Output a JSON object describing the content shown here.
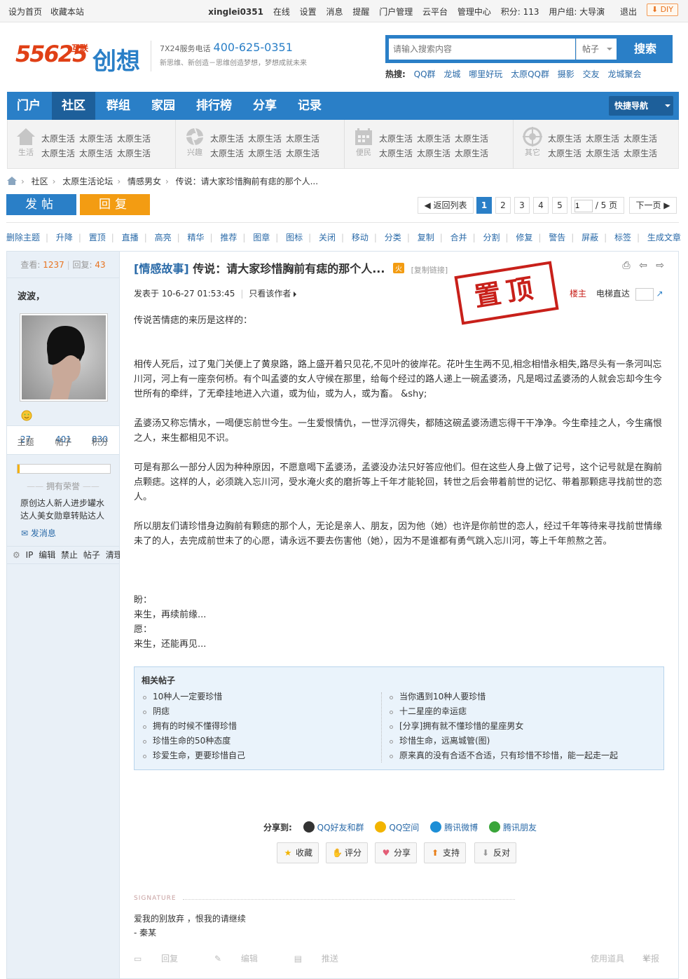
{
  "topbar": {
    "left_links": [
      "设为首页",
      "收藏本站"
    ],
    "username": "xinglei0351",
    "right_links": [
      "在线",
      "设置",
      "消息",
      "提醒",
      "门户管理",
      "云平台",
      "管理中心"
    ],
    "points": "积分: 113",
    "usergroup": "用户组: 大导演",
    "logout": "退出",
    "diy": "DIY"
  },
  "header": {
    "logo_num": "55625",
    "logo_small": "互联",
    "logo_cx": "创想",
    "service_label": "7X24服务电话",
    "phone": "400-625-0351",
    "slogan": "新思维、新创造－思维创造梦想，梦想成就未来",
    "search_placeholder": "请输入搜索内容",
    "search_type": "帖子",
    "search_button": "搜索",
    "hot_label": "热搜:",
    "hot_items": [
      "QQ群",
      "龙城",
      "哪里好玩",
      "太原QQ群",
      "摄影",
      "交友",
      "龙城聚会"
    ]
  },
  "nav": {
    "items": [
      "门户",
      "社区",
      "群组",
      "家园",
      "排行榜",
      "分享",
      "记录"
    ],
    "quick": "快捷导航"
  },
  "subnav": {
    "groups": [
      {
        "icon": "house-icon",
        "label": "生活",
        "row1": [
          "太原生活",
          "太原生活",
          "太原生活"
        ],
        "row2": [
          "太原生活",
          "太原生活",
          "太原生活"
        ]
      },
      {
        "icon": "aperture-icon",
        "label": "兴趣",
        "row1": [
          "太原生活",
          "太原生活",
          "太原生活"
        ],
        "row2": [
          "太原生活",
          "太原生活",
          "太原生活"
        ]
      },
      {
        "icon": "calendar-icon",
        "label": "便民",
        "row1": [
          "太原生活",
          "太原生活",
          "太原生活"
        ],
        "row2": [
          "太原生活",
          "太原生活",
          "太原生活"
        ]
      },
      {
        "icon": "globe-icon",
        "label": "其它",
        "row1": [
          "太原生活",
          "太原生活",
          "太原生活"
        ],
        "row2": [
          "太原生活",
          "太原生活",
          "太原生活"
        ]
      }
    ]
  },
  "breadcrumb": [
    "社区",
    "太原生活论坛",
    "情感男女",
    "传说：请大家珍惜胸前有痣的那个人..."
  ],
  "actions": {
    "post": "发帖",
    "reply": "回复"
  },
  "pager": {
    "back": "返回列表",
    "pages": [
      "1",
      "2",
      "3",
      "4",
      "5"
    ],
    "current": "1",
    "input": "1",
    "total": "/ 5 页",
    "next": "下一页"
  },
  "modbar": [
    "删除主题",
    "升降",
    "置顶",
    "直播",
    "高亮",
    "精华",
    "推荐",
    "图章",
    "图标",
    "关闭",
    "移动",
    "分类",
    "复制",
    "合并",
    "分割",
    "修复",
    "警告",
    "屏蔽",
    "标签",
    "生成文章"
  ],
  "author": {
    "views_label": "查看:",
    "views": "1237",
    "replies_label": "回复:",
    "replies": "43",
    "name": "波波，",
    "stats": [
      {
        "value": "27",
        "label": "主题"
      },
      {
        "value": "401",
        "label": "帖子"
      },
      {
        "value": "830",
        "label": "积分"
      }
    ],
    "level_progress": 0.02,
    "honor_label": "拥有荣誉",
    "medals": "原创达人新人进步罐水达人美女勋章转贴达人",
    "message": "发消息",
    "ops": [
      "IP",
      "编辑",
      "禁止",
      "帖子",
      "清理"
    ]
  },
  "post": {
    "category": "[情感故事]",
    "title": "传说：请大家珍惜胸前有痣的那个人...",
    "hot_badge": "火",
    "copy_link": "[复制链接]",
    "posted": "发表于 10-6-27 01:53:45",
    "only_author": "只看该作者",
    "stamp": "置顶",
    "owner": "楼主",
    "elevator": "电梯直达",
    "paragraphs": [
      "传说苦情痣的来历是这样的：",
      "",
      "相传人死后，过了鬼门关便上了黄泉路，路上盛开着只见花,不见叶的彼岸花。花叶生生两不见,相念相惜永相失,路尽头有一条河叫忘川河，河上有一座奈何桥。有个叫孟婆的女人守候在那里，给每个经过的路人递上一碗孟婆汤，凡是喝过孟婆汤的人就会忘却今生今世所有的牵绊，了无牵挂地进入六道，或为仙，或为人，或为畜。 &shy;",
      "孟婆汤又称忘情水，一喝便忘前世今生。一生爱恨情仇，一世浮沉得失，都随这碗孟婆汤遗忘得干干净净。今生牵挂之人，今生痛恨之人，来生都相见不识。",
      "可是有那么一部分人因为种种原因，不愿意喝下孟婆汤，孟婆没办法只好答应他们。但在这些人身上做了记号，这个记号就是在胸前点颗痣。这样的人，必须跳入忘川河，受水淹火炙的磨折等上千年才能轮回，转世之后会带着前世的记忆、带着那颗痣寻找前世的恋人。",
      "所以朋友们请珍惜身边胸前有颗痣的那个人，无论是亲人、朋友，因为他（她）也许是你前世的恋人，经过千年等待来寻找前世情缘未了的人，去完成前世未了的心愿，请永远不要去伤害他（她），因为不是谁都有勇气跳入忘川河，等上千年煎熬之苦。"
    ],
    "ending": [
      "盼：",
      "来生，再续前缘...",
      "愿：",
      "来生，还能再见..."
    ]
  },
  "related": {
    "title": "相关帖子",
    "left": [
      "10种人一定要珍惜",
      "阴痣",
      "拥有的时候不懂得珍惜",
      "珍惜生命的50种态度",
      "珍爱生命，更要珍惜自己"
    ],
    "right": [
      "当你遇到10种人要珍惜",
      "十二星座的幸运痣",
      "[分享]拥有就不懂珍惜的星座男女",
      "珍惜生命，远离城管(图)",
      "原来真的没有合适不合适，只有珍惜不珍惜，能一起走一起"
    ]
  },
  "share": {
    "label": "分享到:",
    "targets": [
      {
        "name": "QQ好友和群",
        "color": "#333333"
      },
      {
        "name": "QQ空间",
        "color": "#f2b400"
      },
      {
        "name": "腾讯微博",
        "color": "#1d8ed6"
      },
      {
        "name": "腾讯朋友",
        "color": "#3aa53a"
      }
    ]
  },
  "post_actions": [
    {
      "label": "收藏",
      "icon": "star-icon"
    },
    {
      "label": "评分",
      "icon": "thumb-icon"
    },
    {
      "label": "分享",
      "icon": "heart-icon"
    },
    {
      "label": "支持",
      "icon": "up-arrow-icon"
    },
    {
      "label": "反对",
      "icon": "down-arrow-icon"
    }
  ],
  "signature": {
    "label": "SIGNATURE",
    "lines": [
      "爱我的别放弃 ，恨我的请继续",
      "- 秦某"
    ]
  },
  "bottom": {
    "left": [
      "回复",
      "编辑",
      "推送"
    ],
    "right": [
      "使用道具",
      "举报"
    ]
  }
}
